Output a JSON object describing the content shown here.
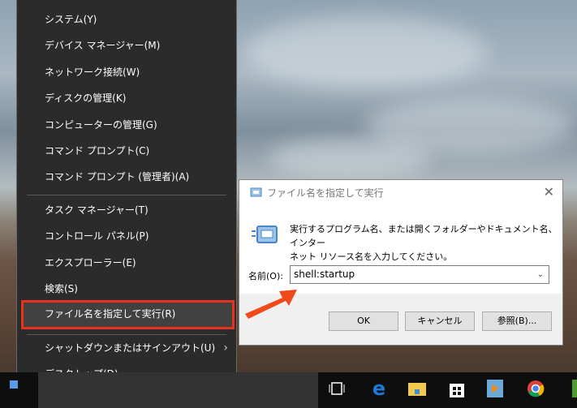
{
  "start_menu": {
    "items": [
      "システム(Y)",
      "デバイス マネージャー(M)",
      "ネットワーク接続(W)",
      "ディスクの管理(K)",
      "コンピューターの管理(G)",
      "コマンド プロンプト(C)",
      "コマンド プロンプト (管理者)(A)",
      "タスク マネージャー(T)",
      "コントロール パネル(P)",
      "エクスプローラー(E)",
      "検索(S)",
      "ファイル名を指定して実行(R)",
      "シャットダウンまたはサインアウト(U)",
      "デスクトップ(D)"
    ]
  },
  "run_dialog": {
    "title": "ファイル名を指定して実行",
    "description_line1": "実行するプログラム名、または開くフォルダーやドキュメント名、インター",
    "description_line2": "ネット リソース名を入力してください。",
    "name_label": "名前(O):",
    "input_value": "shell:startup",
    "ok": "OK",
    "cancel": "キャンセル",
    "browse": "参照(B)..."
  },
  "colors": {
    "highlight_border": "#e8321c",
    "arrow": "#f04a1c"
  }
}
